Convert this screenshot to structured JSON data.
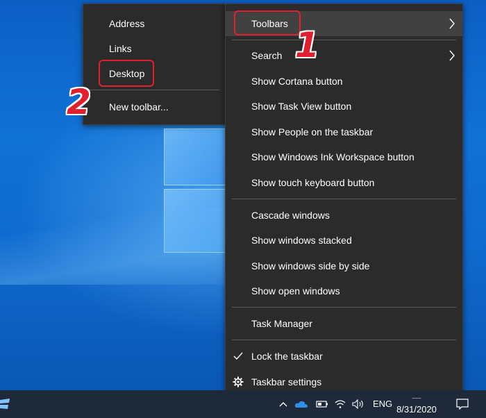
{
  "desktop": {
    "background": "blue windows wallpaper"
  },
  "submenu": {
    "items": [
      {
        "label": "Address"
      },
      {
        "label": "Links"
      },
      {
        "label": "Desktop"
      },
      {
        "label": "New toolbar..."
      }
    ]
  },
  "context_menu": {
    "items": [
      {
        "label": "Toolbars"
      },
      {
        "label": "Search"
      },
      {
        "label": "Show Cortana button"
      },
      {
        "label": "Show Task View button"
      },
      {
        "label": "Show People on the taskbar"
      },
      {
        "label": "Show Windows Ink Workspace button"
      },
      {
        "label": "Show touch keyboard button"
      },
      {
        "label": "Cascade windows"
      },
      {
        "label": "Show windows stacked"
      },
      {
        "label": "Show windows side by side"
      },
      {
        "label": "Show open windows"
      },
      {
        "label": "Task Manager"
      },
      {
        "label": "Lock the taskbar"
      },
      {
        "label": "Taskbar settings"
      }
    ]
  },
  "annotations": {
    "step1": "1",
    "step2": "2",
    "highlight_color": "#e0202e"
  },
  "taskbar": {
    "language": "ENG",
    "date": "8/31/2020"
  },
  "icons": {
    "chevron": "chevron-right-icon",
    "check": "checkmark-icon",
    "settings": "gear-icon",
    "tray_up": "chevron-up-icon",
    "onedrive": "cloud-icon",
    "battery": "battery-icon",
    "wifi": "wifi-icon",
    "volume": "speaker-icon",
    "notifications": "notification-icon"
  }
}
